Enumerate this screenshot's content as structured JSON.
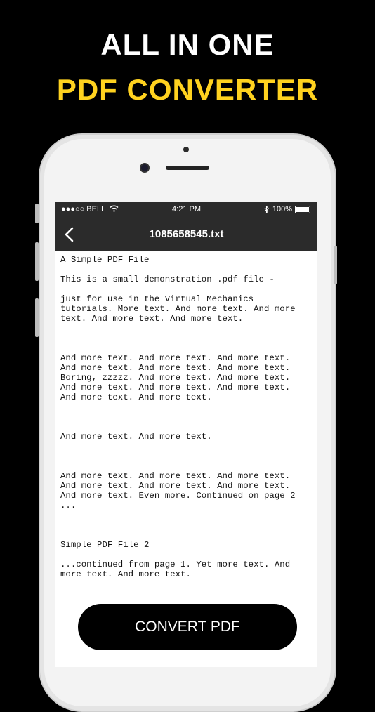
{
  "banner": {
    "line1": "ALL IN ONE",
    "line2": "PDF CONVERTER",
    "line2_color": "#FFD21F"
  },
  "statusbar": {
    "carrier": "●●●○○ BELL",
    "time": "4:21 PM",
    "battery": "100%"
  },
  "navbar": {
    "title": "1085658545.txt",
    "back_icon": "chevron-left-icon"
  },
  "document": {
    "text": "A Simple PDF File\n\nThis is a small demonstration .pdf file -\n\njust for use in the Virtual Mechanics\ntutorials. More text. And more text. And more\ntext. And more text. And more text.\n\n\n\nAnd more text. And more text. And more text.\nAnd more text. And more text. And more text.\nBoring, zzzzz. And more text. And more text.\nAnd more text. And more text. And more text.\nAnd more text. And more text.\n\n\n\nAnd more text. And more text.\n\n\n\nAnd more text. And more text. And more text.\nAnd more text. And more text. And more text.\nAnd more text. Even more. Continued on page 2\n...\n\n\n\nSimple PDF File 2\n\n...continued from page 1. Yet more text. And\nmore text. And more text."
  },
  "actions": {
    "convert_label": "CONVERT PDF"
  }
}
